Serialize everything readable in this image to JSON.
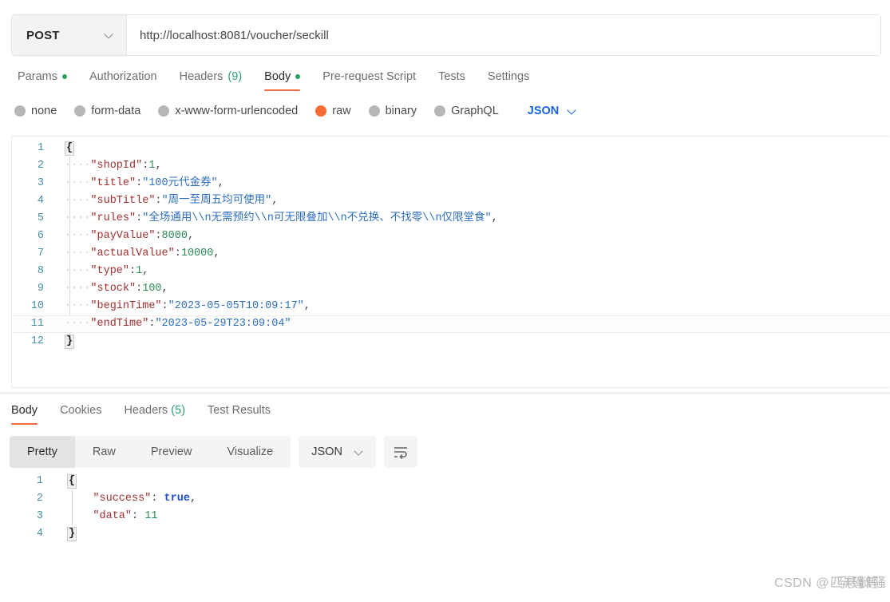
{
  "request": {
    "method": "POST",
    "method_chevron_icon": "chevron-down-icon",
    "url": "http://localhost:8081/voucher/seckill",
    "tabs": [
      {
        "label": "Params",
        "badge": "dot",
        "active": false
      },
      {
        "label": "Authorization",
        "badge": "",
        "active": false
      },
      {
        "label": "Headers",
        "count": "(9)",
        "badge": "",
        "active": false
      },
      {
        "label": "Body",
        "badge": "dot",
        "active": true
      },
      {
        "label": "Pre-request Script",
        "badge": "",
        "active": false
      },
      {
        "label": "Tests",
        "badge": "",
        "active": false
      },
      {
        "label": "Settings",
        "badge": "",
        "active": false
      }
    ],
    "body_types": [
      {
        "label": "none",
        "selected": false
      },
      {
        "label": "form-data",
        "selected": false
      },
      {
        "label": "x-www-form-urlencoded",
        "selected": false
      },
      {
        "label": "raw",
        "selected": true
      },
      {
        "label": "binary",
        "selected": false
      },
      {
        "label": "GraphQL",
        "selected": false
      }
    ],
    "format": {
      "label": "JSON",
      "chevron_icon": "chevron-down-icon"
    },
    "editor": {
      "lines": [
        {
          "n": "1",
          "content": "{"
        },
        {
          "n": "2",
          "content": "    \"shopId\":1,"
        },
        {
          "n": "3",
          "content": "    \"title\":\"100元代金券\","
        },
        {
          "n": "4",
          "content": "    \"subTitle\":\"周一至周五均可使用\","
        },
        {
          "n": "5",
          "content": "    \"rules\":\"全场通用\\\\n无需预约\\\\n可无限叠加\\\\n不兑换、不找零\\\\n仅限堂食\","
        },
        {
          "n": "6",
          "content": "    \"payValue\":8000,"
        },
        {
          "n": "7",
          "content": "    \"actualValue\":10000,"
        },
        {
          "n": "8",
          "content": "    \"type\":1,"
        },
        {
          "n": "9",
          "content": "    \"stock\":100,"
        },
        {
          "n": "10",
          "content": "    \"beginTime\":\"2023-05-05T10:09:17\","
        },
        {
          "n": "11",
          "content": "    \"endTime\":\"2023-05-29T23:09:04\"",
          "active": true
        },
        {
          "n": "12",
          "content": "}"
        }
      ]
    }
  },
  "response": {
    "tabs": [
      {
        "label": "Body",
        "count": "",
        "active": true
      },
      {
        "label": "Cookies",
        "count": "",
        "active": false
      },
      {
        "label": "Headers",
        "count": "(5)",
        "active": false
      },
      {
        "label": "Test Results",
        "count": "",
        "active": false
      }
    ],
    "views": [
      {
        "label": "Pretty",
        "active": true
      },
      {
        "label": "Raw",
        "active": false
      },
      {
        "label": "Preview",
        "active": false
      },
      {
        "label": "Visualize",
        "active": false
      }
    ],
    "format": {
      "label": "JSON",
      "chevron_icon": "chevron-down-icon"
    },
    "wrap_icon": "word-wrap-icon",
    "editor": {
      "lines": [
        {
          "n": "1",
          "content": "{"
        },
        {
          "n": "2",
          "content": "    \"success\": true,"
        },
        {
          "n": "3",
          "content": "    \"data\": 11"
        },
        {
          "n": "4",
          "content": "}"
        }
      ]
    }
  },
  "watermark": {
    "prefix": "CSDN @",
    "name": "匹孕悬篷雠等骚"
  },
  "colors": {
    "accent": "#f26b3a",
    "raw_selected": "#f76c35",
    "link_blue": "#1a62e0",
    "badge_green": "#2aa35a",
    "count_green": "#2f9e6e",
    "gutter": "#4a90a4"
  }
}
